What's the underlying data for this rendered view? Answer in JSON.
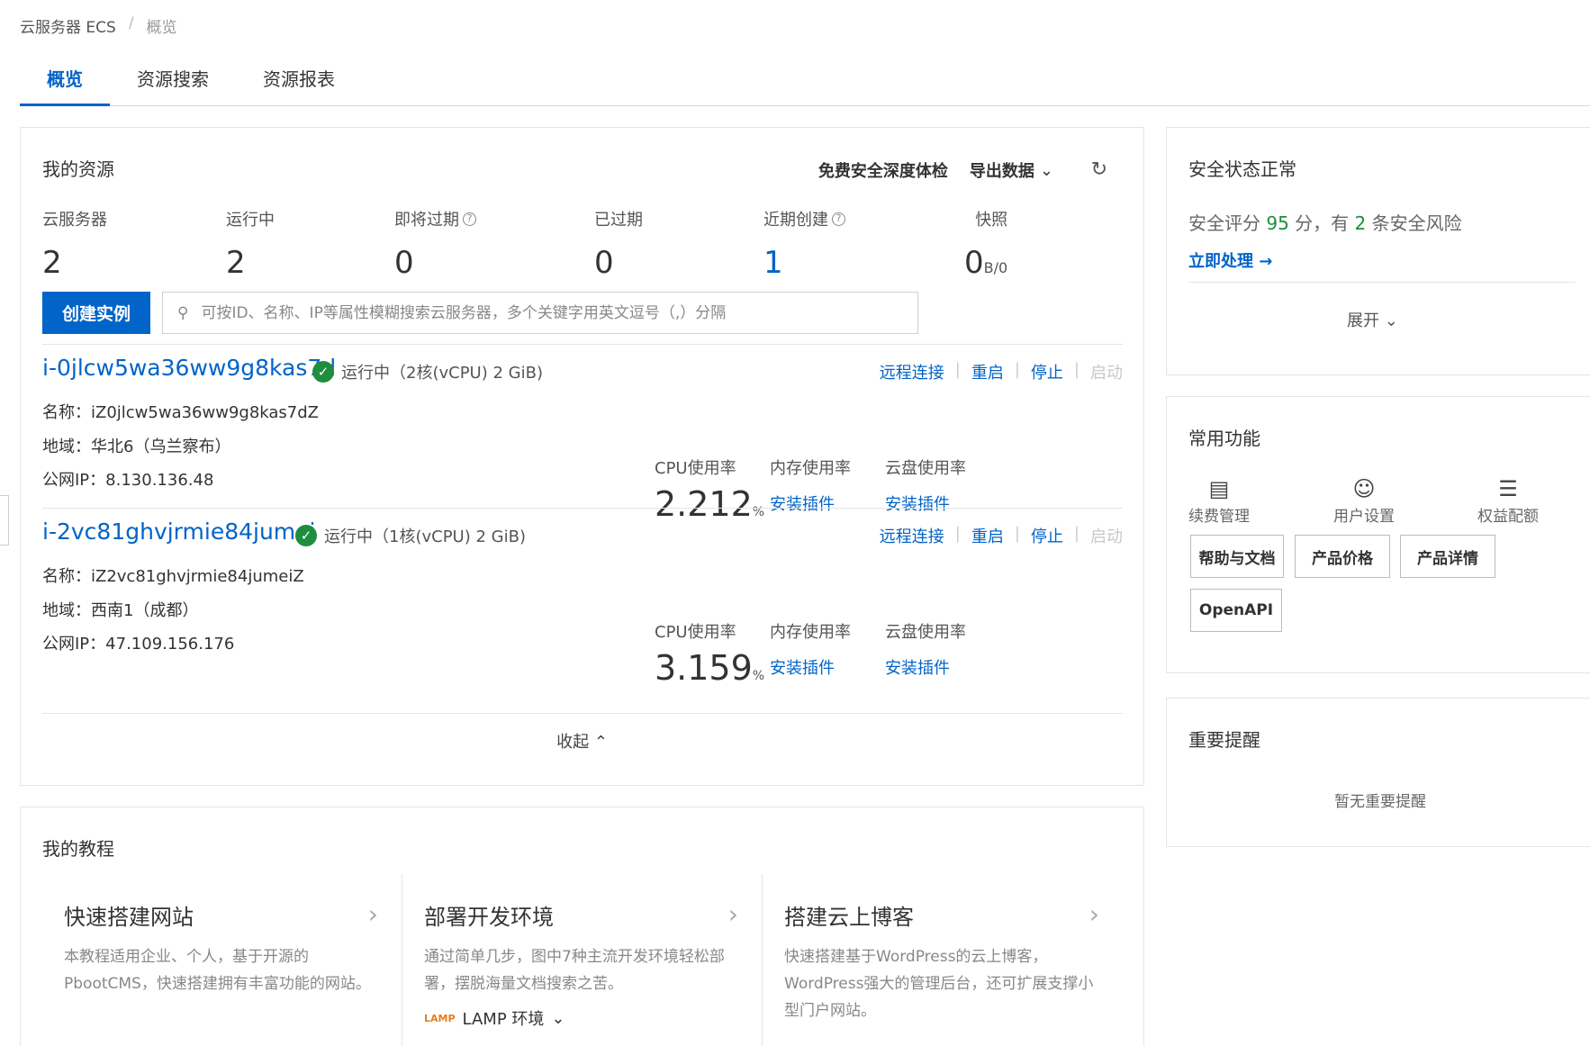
{
  "breadcrumb": {
    "root": "云服务器 ECS",
    "sep": "/",
    "current": "概览"
  },
  "tabs": [
    "概览",
    "资源搜索",
    "资源报表"
  ],
  "resources": {
    "title": "我的资源",
    "actions": {
      "security_check": "免费安全深度体检",
      "export": "导出数据"
    },
    "stats": [
      {
        "label": "云服务器",
        "value": "2"
      },
      {
        "label": "运行中",
        "value": "2"
      },
      {
        "label": "即将过期",
        "value": "0"
      },
      {
        "label": "已过期",
        "value": "0"
      },
      {
        "label": "近期创建",
        "value": "1"
      },
      {
        "label": "快照",
        "value": "0",
        "unit": "B/0"
      }
    ],
    "create_button": "创建实例",
    "search_placeholder": "可按ID、名称、IP等属性模糊搜索云服务器，多个关键字用英文逗号（,）分隔",
    "instances": [
      {
        "id": "i-0jlcw5wa36ww9g8kas7d",
        "status": "运行中（2核(vCPU) 2 GiB)",
        "ops": [
          "远程连接",
          "重启",
          "停止",
          "启动"
        ],
        "name": "名称：iZ0jlcw5wa36ww9g8kas7dZ",
        "region": "地域：华北6（乌兰察布）",
        "ip": "公网IP：8.130.136.48",
        "cpu_label": "CPU使用率",
        "cpu_value": "2.212",
        "cpu_unit": "%",
        "mem_label": "内存使用率",
        "disk_label": "云盘使用率",
        "plugin": "安装插件"
      },
      {
        "id": "i-2vc81ghvjrmie84jumei",
        "status": "运行中（1核(vCPU) 2 GiB)",
        "ops": [
          "远程连接",
          "重启",
          "停止",
          "启动"
        ],
        "name": "名称：iZ2vc81ghvjrmie84jumeiZ",
        "region": "地域：西南1（成都）",
        "ip": "公网IP：47.109.156.176",
        "cpu_label": "CPU使用率",
        "cpu_value": "3.159",
        "cpu_unit": "%",
        "mem_label": "内存使用率",
        "disk_label": "云盘使用率",
        "plugin": "安装插件"
      }
    ],
    "collapse": "收起"
  },
  "tutorials": {
    "title": "我的教程",
    "items": [
      {
        "title": "快速搭建网站",
        "desc": "本教程适用企业、个人，基于开源的PbootCMS，快速搭建拥有丰富功能的网站。"
      },
      {
        "title": "部署开发环境",
        "desc": "通过简单几步，图中7种主流开发环境轻松部署，摆脱海量文档搜索之苦。",
        "extra": "LAMP 环境"
      },
      {
        "title": "搭建云上博客",
        "desc": "快速搭建基于WordPress的云上博客，WordPress强大的管理后台，还可扩展支撑小型门户网站。"
      }
    ]
  },
  "security": {
    "title": "安全状态正常",
    "score_prefix": "安全评分",
    "score": "95",
    "score_mid": "分，有",
    "risks": "2",
    "score_suffix": "条安全风险",
    "action": "立即处理 →",
    "expand": "展开"
  },
  "functions": {
    "title": "常用功能",
    "icons": [
      {
        "label": "续费管理",
        "icon": "renew-icon"
      },
      {
        "label": "用户设置",
        "icon": "user-icon"
      },
      {
        "label": "权益配额",
        "icon": "quota-icon"
      }
    ],
    "buttons": [
      "帮助与文档",
      "产品价格",
      "产品详情",
      "OpenAPI"
    ]
  },
  "reminders": {
    "title": "重要提醒",
    "empty": "暂无重要提醒"
  }
}
